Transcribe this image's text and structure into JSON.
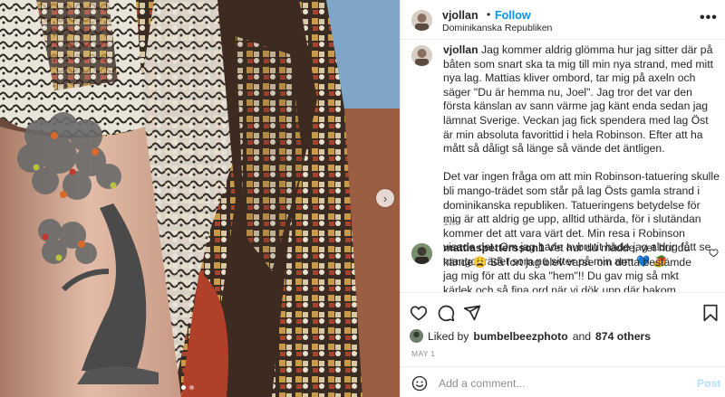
{
  "post": {
    "username": "vjollan",
    "separator": "•",
    "follow_label": "Follow",
    "location": "Dominikanska Republiken",
    "more_label": "•••",
    "caption_user": "vjollan",
    "caption_p1": "Jag kommer aldrig glömma hur jag sitter där på båten som snart ska ta mig till min nya strand, med mitt nya lag. Mattias kliver ombord, tar mig på axeln och säger \"Du är hemma nu, Joel\". Jag tror det var den första känslan av sann värme jag känt enda sedan jag lämnat Sverige. Veckan jag fick spendera med lag Öst är min absoluta favorittid i hela Robinson. Efter att ha mått så dåligt så länge så vände det äntligen.",
    "caption_p2": "Det var ingen fråga om att min Robinson-tatuering skulle bli mango-trädet som står på lag Östs gamla strand i dominikanska republiken. Tatueringens betydelse för mig är att aldrig ge upp, alltid uthärda, för i slutändan kommer det att vara värt det. Min resa i Robinson visade det. Om jag hade avbrutit hade jag aldrig fått se mango-trädet som nu sitter på min arm 💙 🥭",
    "caption_time": "1w",
    "comment_user": "mattiaspettersson1",
    "comment_text": "Vet hur du mådde, vet hur du kände😩 Så fort jag blev varse om detta bestämde jag mig för att du ska \"hem\"!! Du gav mig så mkt kärlek och så fina ord när vi dök upp där bakom ryggen på er vid vårt första möte! Ska jag",
    "liked_by_prefix": "Liked by",
    "liked_by_user": "bumbelbeezphoto",
    "liked_by_and": "and",
    "liked_by_others": "874 others",
    "date": "MAY 1",
    "add_comment_placeholder": "Add a comment...",
    "post_label": "Post"
  },
  "carousel": {
    "next_icon": "›",
    "slide_count": 2,
    "active_slide": 1
  },
  "colors": {
    "accent": "#0095f6",
    "post_disabled": "#b2dffc",
    "muted": "#8e8e8e"
  },
  "icons": [
    "heart-icon",
    "comment-icon",
    "share-icon",
    "bookmark-icon",
    "emoji-icon",
    "more-icon",
    "chevron-right-icon"
  ]
}
